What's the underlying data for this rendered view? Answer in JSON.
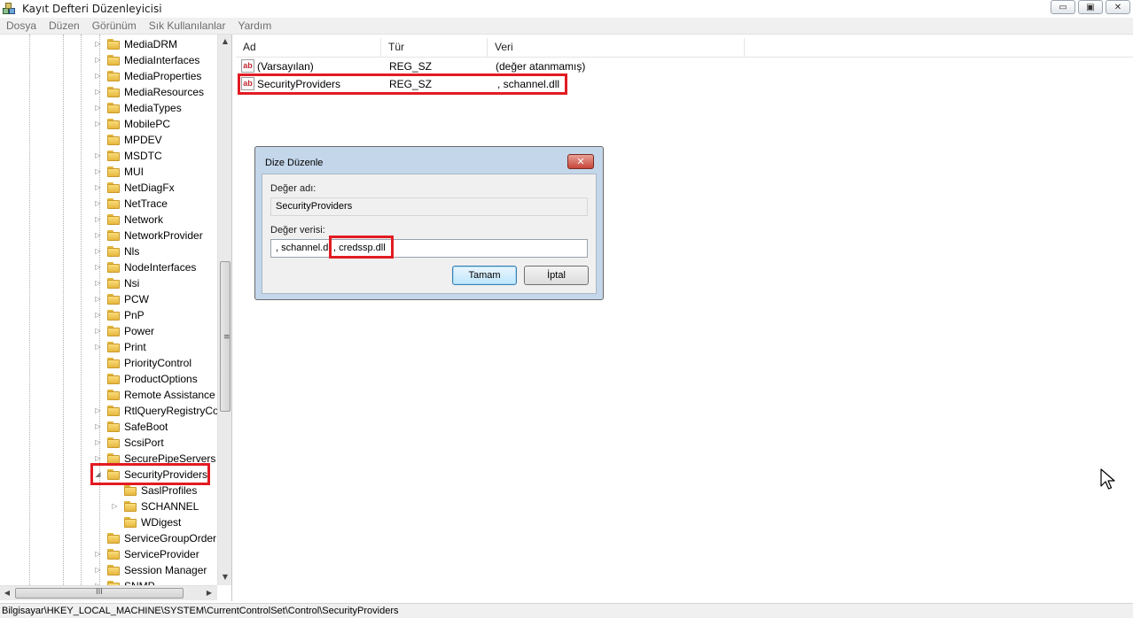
{
  "window": {
    "title": "Kayıt Defteri Düzenleyicisi",
    "controls": {
      "minimize": "▭",
      "maximize": "▣",
      "close": "✕"
    }
  },
  "menu": [
    "Dosya",
    "Düzen",
    "Görünüm",
    "Sık Kullanılanlar",
    "Yardım"
  ],
  "tree": {
    "items": [
      {
        "label": "MediaDRM",
        "expander": "▷"
      },
      {
        "label": "MediaInterfaces",
        "expander": "▷"
      },
      {
        "label": "MediaProperties",
        "expander": "▷"
      },
      {
        "label": "MediaResources",
        "expander": "▷"
      },
      {
        "label": "MediaTypes",
        "expander": "▷"
      },
      {
        "label": "MobilePC",
        "expander": "▷"
      },
      {
        "label": "MPDEV",
        "expander": ""
      },
      {
        "label": "MSDTC",
        "expander": "▷"
      },
      {
        "label": "MUI",
        "expander": "▷"
      },
      {
        "label": "NetDiagFx",
        "expander": "▷"
      },
      {
        "label": "NetTrace",
        "expander": "▷"
      },
      {
        "label": "Network",
        "expander": "▷"
      },
      {
        "label": "NetworkProvider",
        "expander": "▷"
      },
      {
        "label": "Nls",
        "expander": "▷"
      },
      {
        "label": "NodeInterfaces",
        "expander": "▷"
      },
      {
        "label": "Nsi",
        "expander": "▷"
      },
      {
        "label": "PCW",
        "expander": "▷"
      },
      {
        "label": "PnP",
        "expander": "▷"
      },
      {
        "label": "Power",
        "expander": "▷"
      },
      {
        "label": "Print",
        "expander": "▷"
      },
      {
        "label": "PriorityControl",
        "expander": ""
      },
      {
        "label": "ProductOptions",
        "expander": ""
      },
      {
        "label": "Remote Assistance",
        "expander": ""
      },
      {
        "label": "RtlQueryRegistryCo",
        "expander": "▷"
      },
      {
        "label": "SafeBoot",
        "expander": "▷"
      },
      {
        "label": "ScsiPort",
        "expander": "▷"
      },
      {
        "label": "SecurePipeServers",
        "expander": "▷"
      },
      {
        "label": "SecurityProviders",
        "expander": "◢"
      },
      {
        "label": "SaslProfiles",
        "expander": "",
        "child": true
      },
      {
        "label": "SCHANNEL",
        "expander": "▷",
        "child": true
      },
      {
        "label": "WDigest",
        "expander": "",
        "child": true
      },
      {
        "label": "ServiceGroupOrder",
        "expander": ""
      },
      {
        "label": "ServiceProvider",
        "expander": "▷"
      },
      {
        "label": "Session Manager",
        "expander": "▷"
      },
      {
        "label": "SNMP",
        "expander": "▷"
      }
    ],
    "scroll_grip": "≡",
    "hscroll_grip": "III",
    "arrows": {
      "up": "▲",
      "down": "▼",
      "left": "◀",
      "right": "▶"
    }
  },
  "list": {
    "columns": [
      "Ad",
      "Tür",
      "Veri"
    ],
    "rows": [
      {
        "icon": "ab",
        "name": "(Varsayılan)",
        "type": "REG_SZ",
        "data": "(değer atanmamış)"
      },
      {
        "icon": "ab",
        "name": "SecurityProviders",
        "type": "REG_SZ",
        "data": ", schannel.dll"
      }
    ]
  },
  "dialog": {
    "title": "Dize Düzenle",
    "close": "✕",
    "name_label": "Değer adı:",
    "name_value": "SecurityProviders",
    "data_label": "Değer verisi:",
    "data_value_part1": ", schannel.d",
    "data_value_part2": ",  credssp.dll",
    "ok": "Tamam",
    "cancel": "İptal"
  },
  "status": "Bilgisayar\\HKEY_LOCAL_MACHINE\\SYSTEM\\CurrentControlSet\\Control\\SecurityProviders",
  "colors": {
    "highlight": "#e21b22",
    "dialog_frame": "#c4d6ea"
  }
}
